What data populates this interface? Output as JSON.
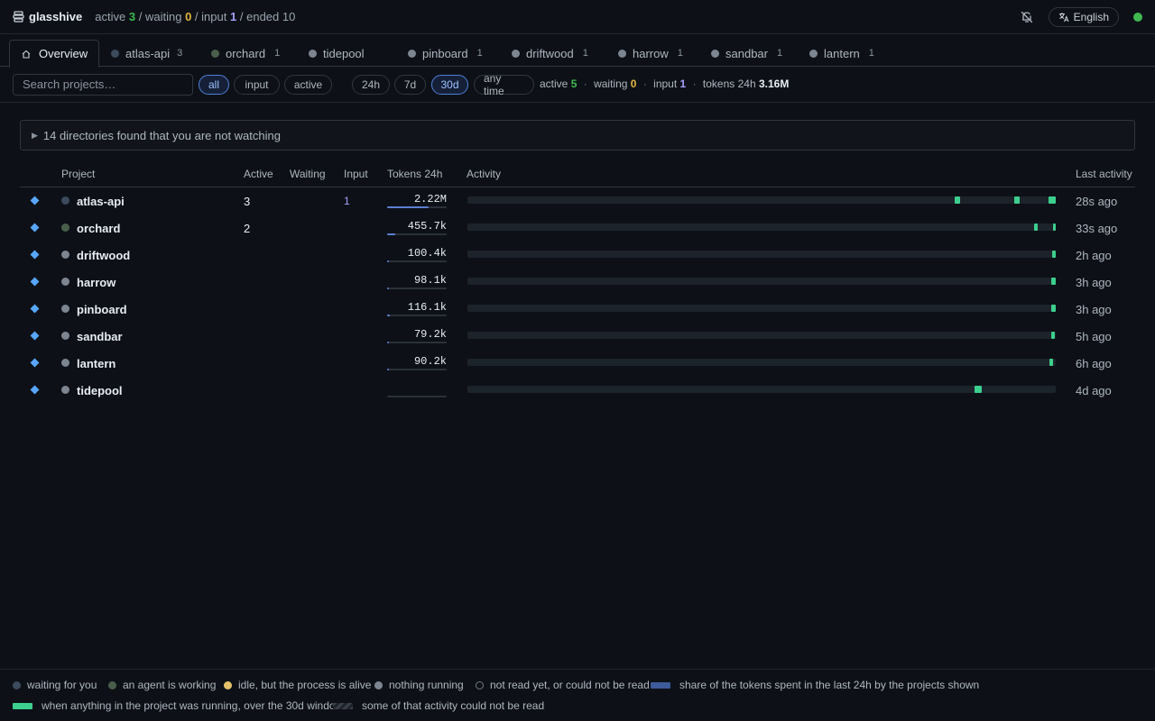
{
  "header": {
    "app_name": "glasshive",
    "counts": {
      "active_label": "active",
      "active": "3",
      "waiting_label": "waiting",
      "waiting": "0",
      "input_label": "input",
      "input": "1",
      "ended_label": "ended",
      "ended": "10",
      "separator": "/"
    },
    "language": "English"
  },
  "tabs": [
    {
      "label": "Overview",
      "count": ""
    },
    {
      "label": "atlas-api",
      "count": "3"
    },
    {
      "label": "orchard",
      "count": "1"
    },
    {
      "label": "tidepool",
      "count": ""
    },
    {
      "label": "pinboard",
      "count": "1"
    },
    {
      "label": "driftwood",
      "count": "1"
    },
    {
      "label": "harrow",
      "count": "1"
    },
    {
      "label": "sandbar",
      "count": "1"
    },
    {
      "label": "lantern",
      "count": "1"
    }
  ],
  "filters": {
    "search_placeholder": "Search projects…",
    "status": [
      "all",
      "input",
      "active"
    ],
    "ranges": [
      "24h",
      "7d",
      "30d",
      "any time"
    ],
    "selected_status": "all",
    "selected_range": "30d"
  },
  "stats": {
    "active_label": "active",
    "active": "5",
    "waiting_label": "waiting",
    "waiting": "0",
    "input_label": "input",
    "input": "1",
    "tokens_label": "tokens 24h",
    "tokens": "3.16M",
    "separator": "·"
  },
  "notice": "14 directories found that you are not watching",
  "table": {
    "columns": [
      "Project",
      "Active",
      "Waiting",
      "Input",
      "Tokens 24h",
      "Activity",
      "Last activity"
    ],
    "rows": [
      {
        "name": "atlas-api",
        "active": "3",
        "waiting": "",
        "input": "1",
        "tokens": "2.22M",
        "token_share": 0.69,
        "last": "28s ago",
        "status": "waiting",
        "activity": [
          [
            0.828,
            0.838
          ],
          [
            0.93,
            0.938
          ],
          [
            0.988,
            1.0
          ]
        ]
      },
      {
        "name": "orchard",
        "active": "2",
        "waiting": "",
        "input": "",
        "tokens": "455.7k",
        "token_share": 0.14,
        "last": "33s ago",
        "status": "working",
        "activity": [
          [
            0.963,
            0.969
          ],
          [
            0.996,
            1.0
          ]
        ]
      },
      {
        "name": "driftwood",
        "active": "",
        "waiting": "",
        "input": "",
        "tokens": "100.4k",
        "token_share": 0.03,
        "last": "2h ago",
        "status": "nothing",
        "activity": [
          [
            0.994,
            1.0
          ]
        ]
      },
      {
        "name": "harrow",
        "active": "",
        "waiting": "",
        "input": "",
        "tokens": "98.1k",
        "token_share": 0.03,
        "last": "3h ago",
        "status": "nothing",
        "activity": [
          [
            0.993,
            1.0
          ]
        ]
      },
      {
        "name": "pinboard",
        "active": "",
        "waiting": "",
        "input": "",
        "tokens": "116.1k",
        "token_share": 0.04,
        "last": "3h ago",
        "status": "nothing",
        "activity": [
          [
            0.993,
            1.0
          ]
        ]
      },
      {
        "name": "sandbar",
        "active": "",
        "waiting": "",
        "input": "",
        "tokens": "79.2k",
        "token_share": 0.025,
        "last": "5h ago",
        "status": "nothing",
        "activity": [
          [
            0.992,
            0.998
          ]
        ]
      },
      {
        "name": "lantern",
        "active": "",
        "waiting": "",
        "input": "",
        "tokens": "90.2k",
        "token_share": 0.028,
        "last": "6h ago",
        "status": "nothing",
        "activity": [
          [
            0.99,
            0.996
          ]
        ]
      },
      {
        "name": "tidepool",
        "active": "",
        "waiting": "",
        "input": "",
        "tokens": "",
        "token_share": 0,
        "last": "4d ago",
        "status": "nothing",
        "activity": [
          [
            0.862,
            0.875
          ]
        ]
      }
    ]
  },
  "legend": [
    {
      "kind": "dot",
      "color": "#3d4a5e",
      "label": "waiting for you"
    },
    {
      "kind": "dot",
      "color": "#4a5e4c",
      "label": "an agent is working"
    },
    {
      "kind": "dot",
      "color": "#e3c16a",
      "label": "idle, but the process is alive"
    },
    {
      "kind": "dot",
      "color": "#7d8590",
      "label": "nothing running"
    },
    {
      "kind": "ring",
      "color": "#6e7681",
      "label": "not read yet, or could not be read"
    },
    {
      "kind": "bar",
      "color": "#3d5a9a",
      "label": "share of the tokens spent in the last 24h by the projects shown"
    },
    {
      "kind": "bar",
      "color": "#3ccf8e",
      "label": "when anything in the project was running, over the 30d window"
    },
    {
      "kind": "hatch",
      "color": "#3a4048",
      "label": "some of that activity could not be read"
    }
  ],
  "colors": {
    "waiting": "#3d4a5e",
    "working": "#4a5e4c",
    "nothing": "#7d8590",
    "accent": "#58a6ff",
    "activity": "#3ccf8e",
    "token_bar": "#5c7fd1"
  }
}
